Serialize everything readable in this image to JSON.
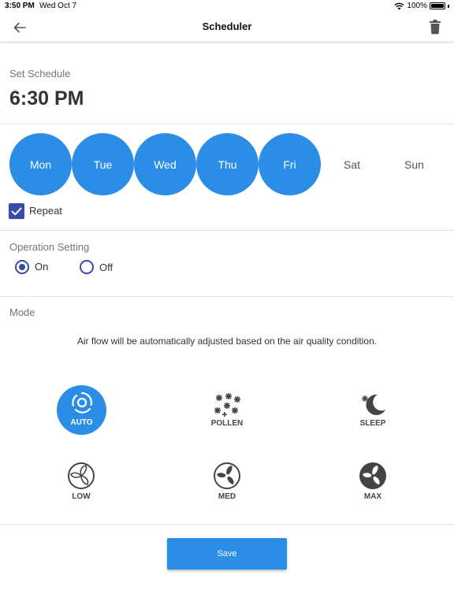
{
  "status_bar": {
    "time": "3:50 PM",
    "date": "Wed Oct 7",
    "battery": "100%"
  },
  "header": {
    "title": "Scheduler"
  },
  "schedule": {
    "label": "Set Schedule",
    "time": "6:30 PM"
  },
  "days": [
    {
      "label": "Mon",
      "selected": true
    },
    {
      "label": "Tue",
      "selected": true
    },
    {
      "label": "Wed",
      "selected": true
    },
    {
      "label": "Thu",
      "selected": true
    },
    {
      "label": "Fri",
      "selected": true
    },
    {
      "label": "Sat",
      "selected": false
    },
    {
      "label": "Sun",
      "selected": false
    }
  ],
  "repeat": {
    "label": "Repeat",
    "checked": true
  },
  "operation": {
    "label": "Operation Setting",
    "on_label": "On",
    "off_label": "Off",
    "selected": "On"
  },
  "mode": {
    "label": "Mode",
    "description": "Air flow will be automatically adjusted based on the air quality condition.",
    "selected": "AUTO",
    "options": [
      "AUTO",
      "POLLEN",
      "SLEEP",
      "LOW",
      "MED",
      "MAX"
    ]
  },
  "save_label": "Save",
  "colors": {
    "accent": "#2b8de6",
    "control": "#3a4aa8"
  }
}
